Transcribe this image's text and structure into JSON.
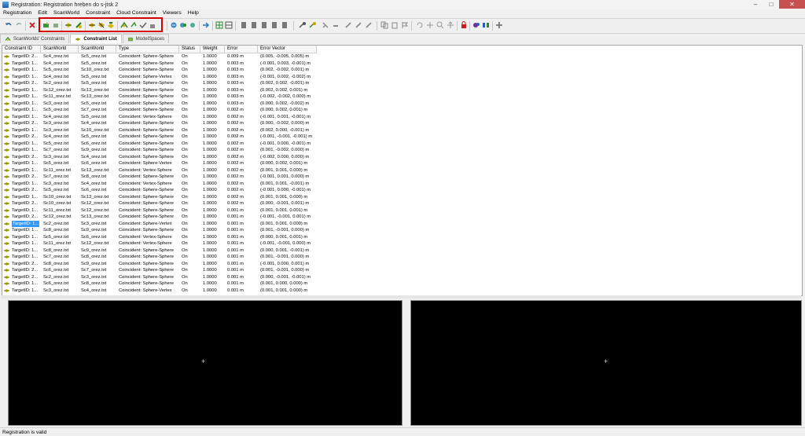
{
  "window": {
    "title": "Registration: Registration hreben do s-jtsk 2",
    "minimize": "–",
    "maximize": "□",
    "close": "✕"
  },
  "menu": [
    "Registration",
    "Edit",
    "ScanWorld",
    "Constraint",
    "Cloud Constraint",
    "Viewers",
    "Help"
  ],
  "tabs": [
    {
      "label": "ScanWorlds' Constraints",
      "active": false
    },
    {
      "label": "Constraint List",
      "active": true
    },
    {
      "label": "ModelSpaces",
      "active": false
    }
  ],
  "colors": {
    "highlight": "#d40000",
    "selection": "#3399ff",
    "viewer_bg": "#000000"
  },
  "table": {
    "headers": [
      "Constraint ID",
      "ScanWorld",
      "ScanWorld",
      "Type",
      "Status",
      "Weight",
      "Error",
      "Error Vector"
    ],
    "rows": [
      [
        "TargetID: 2...",
        "Sc4_orez.txt",
        "Sc5_orez.txt",
        "Coincident: Sphere-Sphere",
        "On",
        "1.0000",
        "0.009 m",
        "(0.005, -0.005, 0.005) m"
      ],
      [
        "TargetID: 1...",
        "Sc4_orez.txt",
        "Sc5_orez.txt",
        "Coincident: Sphere-Sphere",
        "On",
        "1.0000",
        "0.003 m",
        "(-0.001, 0.003, -0.001) m"
      ],
      [
        "TargetID: 1...",
        "Sc5_orez.txt",
        "Sc10_orez.txt",
        "Coincident: Sphere-Sphere",
        "On",
        "1.0000",
        "0.003 m",
        "(0.002, -0.002, 0.001) m"
      ],
      [
        "TargetID: 1...",
        "Sc4_orez.txt",
        "Sc5_orez.txt",
        "Coincident: Sphere-Vertex",
        "On",
        "1.0000",
        "0.003 m",
        "(-0.001, 0.002, -0.002) m"
      ],
      [
        "TargetID: 2...",
        "Sc2_orez.txt",
        "Sc5_orez.txt",
        "Coincident: Sphere-Sphere",
        "On",
        "1.0000",
        "0.003 m",
        "(0.002, 0.002, -0.001) m"
      ],
      [
        "TargetID: 1...",
        "Sc12_orez.txt",
        "Sc13_orez.txt",
        "Coincident: Sphere-Sphere",
        "On",
        "1.0000",
        "0.003 m",
        "(0.002, 0.002, 0.001) m"
      ],
      [
        "TargetID: 1...",
        "Sc11_orez.txt",
        "Sc13_orez.txt",
        "Coincident: Sphere-Sphere",
        "On",
        "1.0000",
        "0.003 m",
        "(-0.002, -0.002, 0.000) m"
      ],
      [
        "TargetID: 1...",
        "Sc3_orez.txt",
        "Sc5_orez.txt",
        "Coincident: Sphere-Sphere",
        "On",
        "1.0000",
        "0.003 m",
        "(0.000, 0.002, -0.002) m"
      ],
      [
        "TargetID: 1...",
        "Sc5_orez.txt",
        "Sc7_orez.txt",
        "Coincident: Sphere-Sphere",
        "On",
        "1.0000",
        "0.002 m",
        "(0.000, 0.002, 0.001) m"
      ],
      [
        "TargetID: 1...",
        "Sc4_orez.txt",
        "Sc5_orez.txt",
        "Coincident: Vertex-Sphere",
        "On",
        "1.0000",
        "0.002 m",
        "(-0.001, 0.001, -0.001) m"
      ],
      [
        "TargetID: 2...",
        "Sc3_orez.txt",
        "Sc4_orez.txt",
        "Coincident: Sphere-Sphere",
        "On",
        "1.0000",
        "0.002 m",
        "(0.000, -0.002, 0.000) m"
      ],
      [
        "TargetID: 1...",
        "Sc3_orez.txt",
        "Sc10_orez.txt",
        "Coincident: Sphere-Sphere",
        "On",
        "1.0000",
        "0.002 m",
        "(0.002, 0.000, -0.001) m"
      ],
      [
        "TargetID: 2...",
        "Sc4_orez.txt",
        "Sc5_orez.txt",
        "Coincident: Sphere-Sphere",
        "On",
        "1.0000",
        "0.002 m",
        "(-0.001, -0.001, -0.001) m"
      ],
      [
        "TargetID: 1...",
        "Sc5_orez.txt",
        "Sc6_orez.txt",
        "Coincident: Sphere-Sphere",
        "On",
        "1.0000",
        "0.002 m",
        "(-0.001, 0.000, -0.001) m"
      ],
      [
        "TargetID: 1...",
        "Sc7_orez.txt",
        "Sc9_orez.txt",
        "Coincident: Sphere-Sphere",
        "On",
        "1.0000",
        "0.002 m",
        "(0.001, -0.002, 0.000) m"
      ],
      [
        "TargetID: 2...",
        "Sc3_orez.txt",
        "Sc4_orez.txt",
        "Coincident: Sphere-Sphere",
        "On",
        "1.0000",
        "0.002 m",
        "(-0.002, 0.000, 0.000) m"
      ],
      [
        "TargetID: 1...",
        "Sc5_orez.txt",
        "Sc6_orez.txt",
        "Coincident: Sphere-Vertex",
        "On",
        "1.0000",
        "0.002 m",
        "(0.000, 0.002, 0.001) m"
      ],
      [
        "TargetID: 1...",
        "Sc11_orez.txt",
        "Sc13_orez.txt",
        "Coincident: Vertex-Sphere",
        "On",
        "1.0000",
        "0.002 m",
        "(0.001, 0.001, 0.000) m"
      ],
      [
        "TargetID: 2...",
        "Sc7_orez.txt",
        "Sc8_orez.txt",
        "Coincident: Sphere-Sphere",
        "On",
        "1.0000",
        "0.002 m",
        "(-0.001, 0.001, 0.000) m"
      ],
      [
        "TargetID: 1...",
        "Sc3_orez.txt",
        "Sc4_orez.txt",
        "Coincident: Vertex-Sphere",
        "On",
        "1.0000",
        "0.002 m",
        "(0.001, 0.001, -0.001) m"
      ],
      [
        "TargetID: 2...",
        "Sc5_orez.txt",
        "Sc6_orez.txt",
        "Coincident: Sphere-Sphere",
        "On",
        "1.0000",
        "0.002 m",
        "(-0.001, 0.000, -0.001) m"
      ],
      [
        "TargetID: 1...",
        "Sc10_orez.txt",
        "Sc13_orez.txt",
        "Coincident: Sphere-Sphere",
        "On",
        "1.0000",
        "0.002 m",
        "(0.001, 0.001, 0.000) m"
      ],
      [
        "TargetID: 2...",
        "Sc10_orez.txt",
        "Sc12_orez.txt",
        "Coincident: Sphere-Sphere",
        "On",
        "1.0000",
        "0.002 m",
        "(0.000, -0.001, 0.001) m"
      ],
      [
        "TargetID: 1...",
        "Sc11_orez.txt",
        "Sc12_orez.txt",
        "Coincident: Sphere-Sphere",
        "On",
        "1.0000",
        "0.001 m",
        "(0.001, 0.001, 0.001) m"
      ],
      [
        "TargetID: 2...",
        "Sc12_orez.txt",
        "Sc13_orez.txt",
        "Coincident: Sphere-Sphere",
        "On",
        "1.0000",
        "0.001 m",
        "(-0.001, -0.001, 0.001) m"
      ],
      [
        "TargetID: 1...",
        "Sc2_orez.txt",
        "Sc3_orez.txt",
        "Coincident: Sphere-Vertex",
        "On",
        "1.0000",
        "0.001 m",
        "(0.001, 0.001, 0.000) m"
      ],
      [
        "TargetID: 1...",
        "Sc8_orez.txt",
        "Sc9_orez.txt",
        "Coincident: Sphere-Sphere",
        "On",
        "1.0000",
        "0.001 m",
        "(0.001, -0.001, 0.000) m"
      ],
      [
        "TargetID: 1...",
        "Sc5_orez.txt",
        "Sc6_orez.txt",
        "Coincident: Vertex-Sphere",
        "On",
        "1.0000",
        "0.001 m",
        "(0.000, 0.001, 0.001) m"
      ],
      [
        "TargetID: 1...",
        "Sc11_orez.txt",
        "Sc12_orez.txt",
        "Coincident: Vertex-Sphere",
        "On",
        "1.0000",
        "0.001 m",
        "(-0.001, -0.001, 0.000) m"
      ],
      [
        "TargetID: 1...",
        "Sc8_orez.txt",
        "Sc9_orez.txt",
        "Coincident: Sphere-Sphere",
        "On",
        "1.0000",
        "0.001 m",
        "(0.000, 0.001, -0.001) m"
      ],
      [
        "TargetID: 1...",
        "Sc7_orez.txt",
        "Sc8_orez.txt",
        "Coincident: Sphere-Sphere",
        "On",
        "1.0000",
        "0.001 m",
        "(0.001, -0.001, 0.000) m"
      ],
      [
        "TargetID: 2...",
        "Sc8_orez.txt",
        "Sc9_orez.txt",
        "Coincident: Sphere-Sphere",
        "On",
        "1.0000",
        "0.001 m",
        "(-0.001, 0.000, 0.001) m"
      ],
      [
        "TargetID: 2...",
        "Sc6_orez.txt",
        "Sc7_orez.txt",
        "Coincident: Sphere-Sphere",
        "On",
        "1.0000",
        "0.001 m",
        "(0.001, -0.001, 0.000) m"
      ],
      [
        "TargetID: 2...",
        "Sc2_orez.txt",
        "Sc3_orez.txt",
        "Coincident: Sphere-Sphere",
        "On",
        "1.0000",
        "0.001 m",
        "(0.000, -0.001, -0.001) m"
      ],
      [
        "TargetID: 1...",
        "Sc6_orez.txt",
        "Sc8_orez.txt",
        "Coincident: Sphere-Sphere",
        "On",
        "1.0000",
        "0.001 m",
        "(0.001, 0.000, 0.000) m"
      ],
      [
        "TargetID: 1...",
        "Sc3_orez.txt",
        "Sc4_orez.txt",
        "Coincident: Sphere-Vertex",
        "On",
        "1.0000",
        "0.001 m",
        "(0.001, 0.001, 0.000) m"
      ]
    ],
    "selected_row": 25
  },
  "viewers": {
    "crosshair": "+"
  },
  "status": "Registration is valid"
}
